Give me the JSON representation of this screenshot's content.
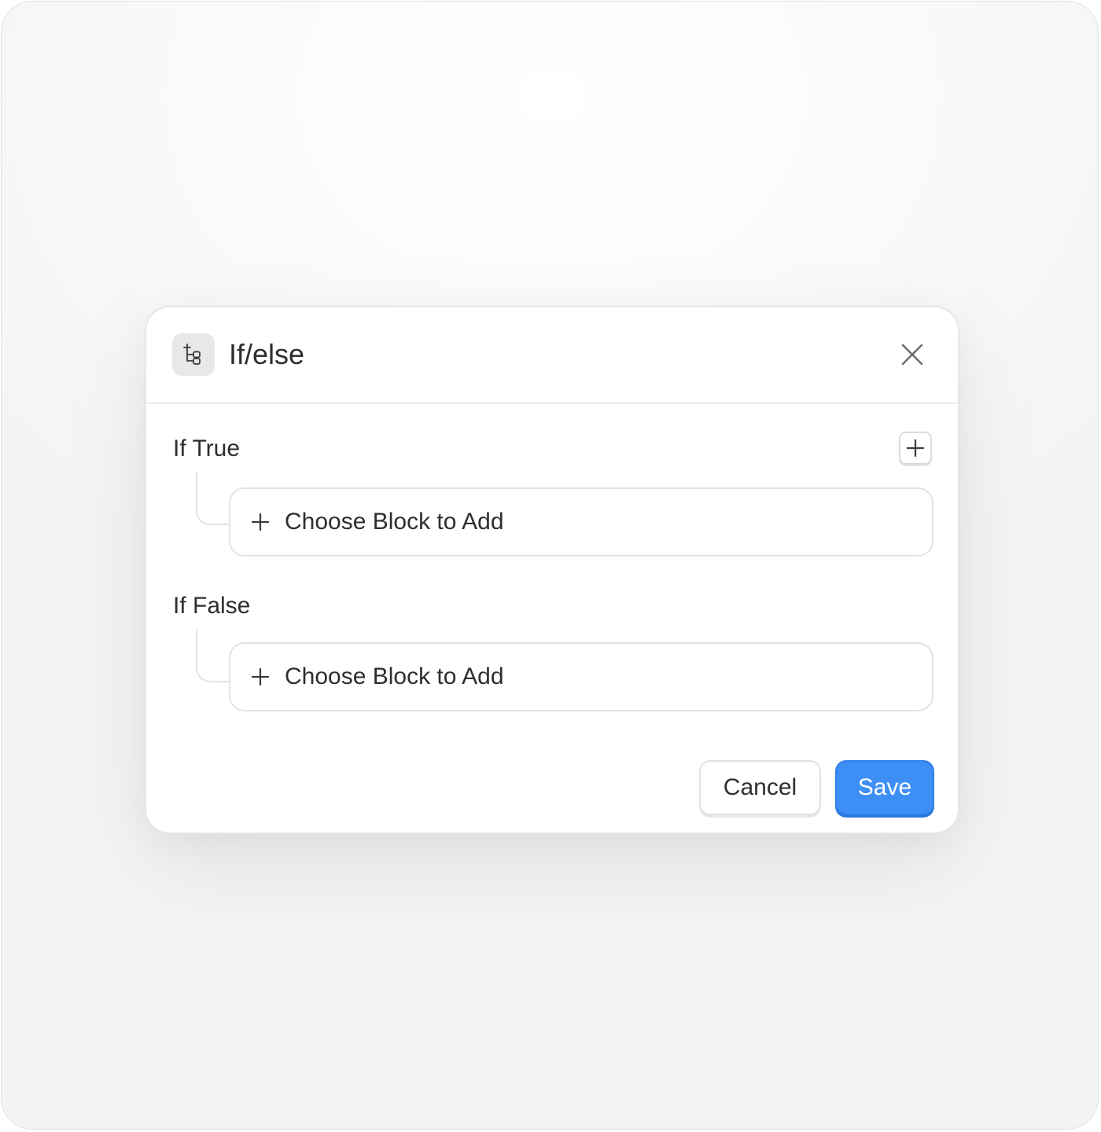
{
  "dialog": {
    "title": "If/else",
    "header_icon": "branch-icon",
    "close_icon": "close-icon"
  },
  "sections": [
    {
      "label": "If True",
      "add_icon": "plus-icon",
      "choose_block_label": "Choose Block to Add"
    },
    {
      "label": "If False",
      "choose_block_label": "Choose Block to Add"
    }
  ],
  "footer": {
    "cancel_label": "Cancel",
    "save_label": "Save"
  },
  "colors": {
    "accent": "#3d8ff5",
    "border": "#e3e3e3",
    "icon_bg": "#e8e8e8",
    "text": "#2e2e2e"
  }
}
